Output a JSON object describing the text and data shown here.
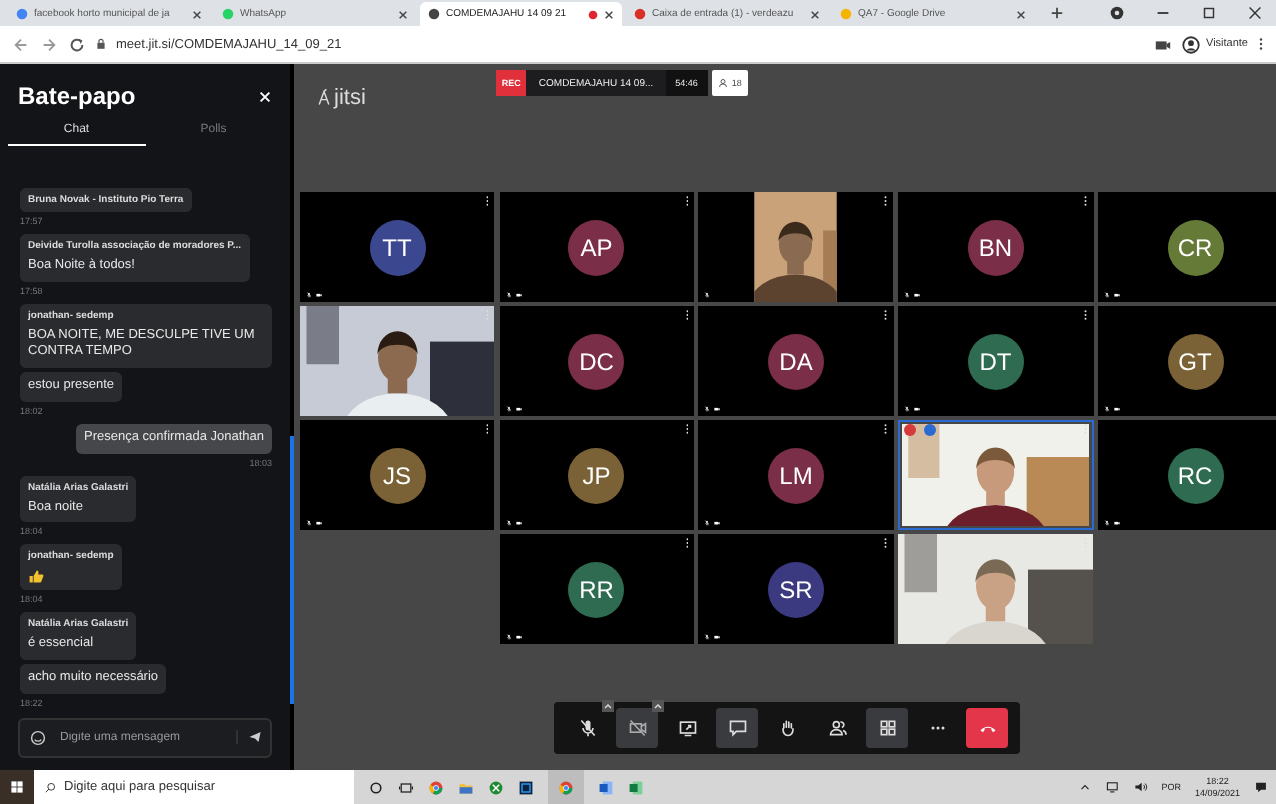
{
  "browser": {
    "tabs": [
      {
        "title": "facebook horto municipal de ja",
        "color": "#4285f4",
        "selected": false,
        "recording": false
      },
      {
        "title": "WhatsApp",
        "color": "#25d366",
        "selected": false,
        "recording": false
      },
      {
        "title": "COMDEMAJAHU 14 09 21",
        "color": "#444444",
        "selected": true,
        "recording": true
      },
      {
        "title": "Caixa de entrada (1) - verdeazu",
        "color": "#d93025",
        "selected": false,
        "recording": false
      },
      {
        "title": "QA7 - Google Drive",
        "color": "#f4b400",
        "selected": false,
        "recording": false
      }
    ],
    "url": "meet.jit.si/COMDEMAJAHU_14_09_21",
    "profile": "Visitante"
  },
  "chat": {
    "title": "Bate-papo",
    "tabs": [
      {
        "label": "Chat",
        "selected": true
      },
      {
        "label": "Polls",
        "selected": false
      }
    ],
    "groups": [
      {
        "sender": "Bruna Novak - Instituto Pio Terra",
        "own": false,
        "time": "17:57"
      },
      {
        "sender": "Deivide Turolla associação de moradores P...",
        "own": false,
        "bubbles": [
          {
            "kind": "text",
            "text": "Boa Noite à todos!"
          }
        ],
        "time": "17:58"
      },
      {
        "sender": "jonathan- sedemp",
        "own": false,
        "bubbles": [
          {
            "kind": "text",
            "text": "BOA NOITE, ME DESCULPE TIVE UM CONTRA TEMPO"
          },
          {
            "kind": "text",
            "text": "estou presente"
          }
        ],
        "time": "18:02"
      },
      {
        "own": true,
        "bubbles": [
          {
            "kind": "text",
            "text": "Presença confirmada Jonathan"
          }
        ],
        "time": "18:03"
      },
      {
        "sender": "Natália Arias Galastri",
        "own": false,
        "bubbles": [
          {
            "kind": "text",
            "text": "Boa noite"
          }
        ],
        "time": "18:04"
      },
      {
        "sender": "jonathan- sedemp",
        "own": false,
        "bubbles": [
          {
            "kind": "thumbs_up"
          }
        ],
        "time": "18:04"
      },
      {
        "sender": "Natália Arias Galastri",
        "own": false,
        "bubbles": [
          {
            "kind": "text",
            "text": "é essencial"
          },
          {
            "kind": "text",
            "text": "acho muito necessário"
          }
        ],
        "time": "18:22"
      }
    ],
    "placeholder": "Digite uma mensagem"
  },
  "meeting": {
    "logo": "jitsi",
    "rec": "REC",
    "name": "COMDEMAJAHU 14 09...",
    "timer": "54:46",
    "participants": "18",
    "tiles": [
      {
        "kind": "avatar",
        "initials": "TT",
        "color": "#3b4890",
        "audio_muted": true,
        "video_muted": true
      },
      {
        "kind": "avatar",
        "initials": "AP",
        "color": "#7a2e48",
        "audio_muted": true,
        "video_muted": true
      },
      {
        "kind": "video_narrow",
        "audio_muted": true,
        "video_muted": false
      },
      {
        "kind": "avatar",
        "initials": "BN",
        "color": "#7a2e48",
        "audio_muted": true,
        "video_muted": true
      },
      {
        "kind": "avatar",
        "initials": "CR",
        "color": "#667a38",
        "audio_muted": true,
        "video_muted": true
      },
      {
        "kind": "video",
        "audio_muted": false,
        "video_muted": false
      },
      {
        "kind": "avatar",
        "initials": "DC",
        "color": "#7a2e48",
        "audio_muted": true,
        "video_muted": true
      },
      {
        "kind": "avatar",
        "initials": "DA",
        "color": "#7a2e48",
        "audio_muted": true,
        "video_muted": true
      },
      {
        "kind": "avatar",
        "initials": "DT",
        "color": "#2e6b50",
        "audio_muted": true,
        "video_muted": true
      },
      {
        "kind": "avatar",
        "initials": "GT",
        "color": "#7a6236",
        "audio_muted": true,
        "video_muted": true
      },
      {
        "kind": "avatar",
        "initials": "JS",
        "color": "#7a6236",
        "audio_muted": true,
        "video_muted": true
      },
      {
        "kind": "avatar",
        "initials": "JP",
        "color": "#7a6236",
        "audio_muted": true,
        "video_muted": true
      },
      {
        "kind": "avatar",
        "initials": "LM",
        "color": "#7a2e48",
        "audio_muted": true,
        "video_muted": true
      },
      {
        "kind": "video",
        "audio_muted": false,
        "video_muted": false,
        "dominant": true,
        "badges": [
          {
            "color": "#d63a3a"
          },
          {
            "color": "#2a6bd1"
          }
        ]
      },
      {
        "kind": "avatar",
        "initials": "RC",
        "color": "#2e6b50",
        "audio_muted": true,
        "video_muted": true
      },
      {
        "kind": "avatar",
        "initials": "RR",
        "color": "#2e6b50",
        "audio_muted": true,
        "video_muted": true
      },
      {
        "kind": "avatar",
        "initials": "SR",
        "color": "#3b3a80",
        "audio_muted": true,
        "video_muted": true
      },
      {
        "kind": "video",
        "audio_muted": false,
        "video_muted": false
      }
    ],
    "toolbar": [
      {
        "kind": "mic",
        "active": false,
        "menu": true
      },
      {
        "kind": "camera",
        "active": true,
        "menu": true
      },
      {
        "kind": "share",
        "active": false,
        "menu": false
      },
      {
        "kind": "chat",
        "active": true,
        "menu": false
      },
      {
        "kind": "hand",
        "active": false,
        "menu": false
      },
      {
        "kind": "participants",
        "active": false,
        "menu": false
      },
      {
        "kind": "tileview",
        "active": true,
        "menu": false
      },
      {
        "kind": "more",
        "active": false,
        "menu": false
      },
      {
        "kind": "hangup",
        "active": false,
        "menu": false
      }
    ]
  },
  "taskbar": {
    "search_placeholder": "Digite aqui para pesquisar",
    "language": "POR",
    "time": "18:22",
    "date": "14/09/2021"
  }
}
